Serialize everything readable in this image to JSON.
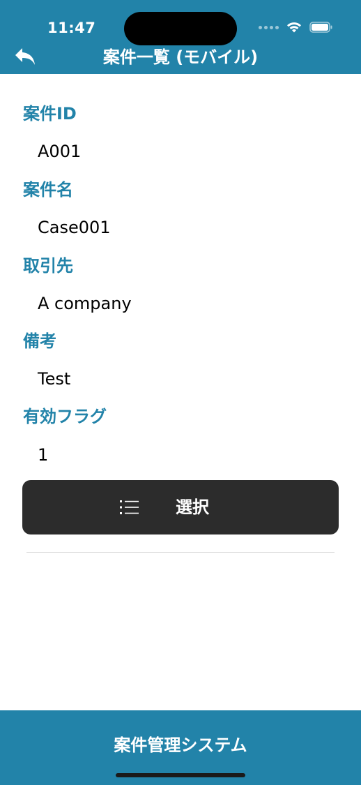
{
  "status_bar": {
    "time": "11:47"
  },
  "header": {
    "title": "案件一覧 (モバイル)",
    "back_icon": "back-arrow-icon",
    "background_color": "#2283a9"
  },
  "fields": [
    {
      "label": "案件ID",
      "value": "A001"
    },
    {
      "label": "案件名",
      "value": "Case001"
    },
    {
      "label": "取引先",
      "value": "A company"
    },
    {
      "label": "備考",
      "value": "Test"
    },
    {
      "label": "有効フラグ",
      "value": "1"
    }
  ],
  "select_button": {
    "label": "選択",
    "icon": "list-icon",
    "background_color": "#2c2c2c"
  },
  "footer": {
    "title": "案件管理システム"
  },
  "colors": {
    "accent": "#2283a9",
    "label": "#2283a9",
    "text": "#000000"
  }
}
